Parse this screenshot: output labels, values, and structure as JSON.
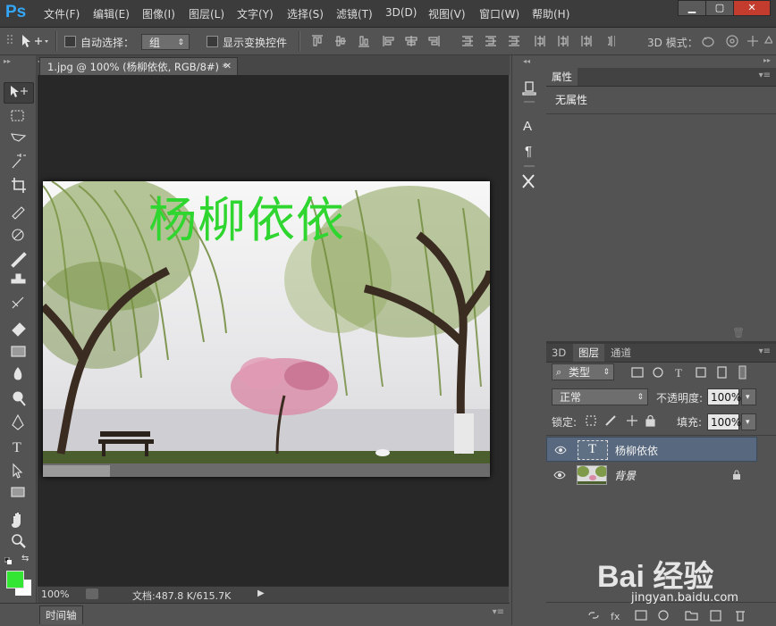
{
  "app": {
    "logo": "Ps",
    "accent": "#33a6f8"
  },
  "menu": [
    "文件(F)",
    "编辑(E)",
    "图像(I)",
    "图层(L)",
    "文字(Y)",
    "选择(S)",
    "滤镜(T)",
    "3D(D)",
    "视图(V)",
    "窗口(W)",
    "帮助(H)"
  ],
  "window_controls": {
    "minimize": "▁",
    "maximize": "▢",
    "close": "✕"
  },
  "options": {
    "auto_select_label": "自动选择：",
    "auto_select_value": "组",
    "show_transform_label": "显示变换控件",
    "mode_3d_label": "3D 模式："
  },
  "document": {
    "tab_title": "1.jpg @ 100% (杨柳依依, RGB/8#) *",
    "overlay_text": "杨柳依依",
    "overlay_color": "#2fd62f",
    "zoom": "100%",
    "doc_info": "文档:487.8 K/615.7K"
  },
  "timeline_label": "时间轴",
  "properties": {
    "tab": "属性",
    "content": "无属性"
  },
  "layers_panel": {
    "tabs": [
      "3D",
      "图层",
      "通道"
    ],
    "filter_label": "类型",
    "blend_mode": "正常",
    "opacity_label": "不透明度:",
    "opacity_value": "100%",
    "lock_label": "锁定:",
    "fill_label": "填充:",
    "fill_value": "100%",
    "layers": [
      {
        "name": "杨柳依依",
        "type_glyph": "T",
        "selected": true
      },
      {
        "name": "背景",
        "locked": true
      }
    ]
  },
  "foreground_color": "#33e633",
  "background_color": "#ffffff",
  "watermark": {
    "brand": "Bai 经验",
    "url": "jingyan.baidu.com"
  }
}
